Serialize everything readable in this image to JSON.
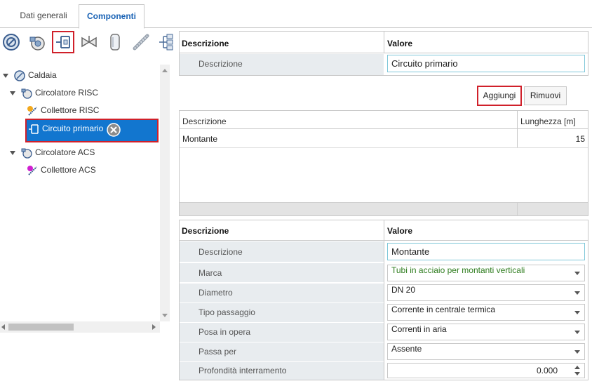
{
  "tabs": [
    {
      "label": "Dati generali"
    },
    {
      "label": "Componenti"
    }
  ],
  "toolbar": {
    "icons": [
      "caldaia-icon",
      "circolatore-icon",
      "circuito-icon",
      "valvola-icon",
      "serbatoio-icon",
      "tubo-icon",
      "collettore-icon"
    ]
  },
  "tree": {
    "root": "Caldaia",
    "items": [
      {
        "label": "Circolatore RISC"
      },
      {
        "label": "Collettore RISC"
      },
      {
        "label": "Circuito primario"
      },
      {
        "label": "Circolatore ACS"
      },
      {
        "label": "Collettore ACS"
      }
    ]
  },
  "top_props": {
    "col_desc": "Descrizione",
    "col_val": "Valore",
    "row_label": "Descrizione",
    "row_value": "Circuito primario"
  },
  "buttons": {
    "add": "Aggiungi",
    "remove": "Rimuovi"
  },
  "segments": {
    "col_desc": "Descrizione",
    "col_len": "Lunghezza [m]",
    "rows": [
      {
        "desc": "Montante",
        "len": "15"
      }
    ]
  },
  "bottom_props": {
    "col_desc": "Descrizione",
    "col_val": "Valore",
    "rows": [
      {
        "label": "Descrizione",
        "value": "Montante"
      },
      {
        "label": "Marca",
        "value": "Tubi in acciaio per montanti verticali"
      },
      {
        "label": "Diametro",
        "value": "DN 20"
      },
      {
        "label": "Tipo passaggio",
        "value": "Corrente in centrale termica"
      },
      {
        "label": "Posa in opera",
        "value": "Correnti in aria"
      },
      {
        "label": "Passa per",
        "value": "Assente"
      },
      {
        "label": "Profondità interramento",
        "value": "0.000"
      }
    ]
  },
  "colors": {
    "accent": "#1a63b5",
    "selection": "#1276cf",
    "highlight_border": "#d0202a",
    "marca_text": "#2f7d1f"
  }
}
